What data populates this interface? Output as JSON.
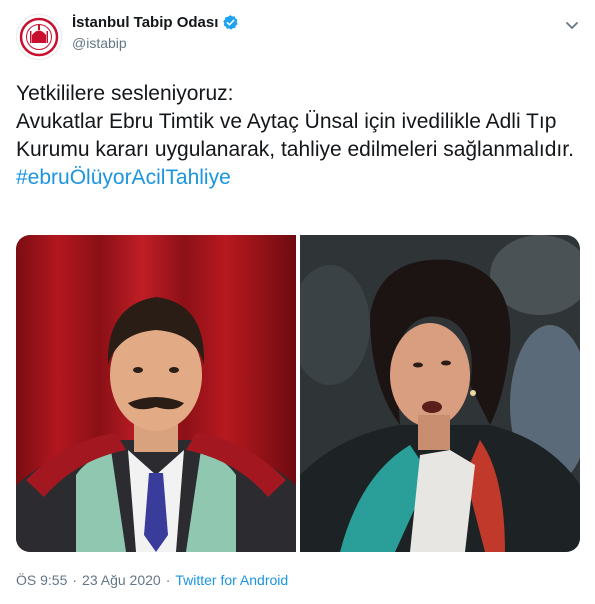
{
  "user": {
    "display_name": "İstanbul Tabip Odası",
    "handle": "@istabip",
    "verified": true,
    "avatar_icon": "medical-chamber-logo"
  },
  "tweet": {
    "text": "Yetkililere sesleniyoruz:\nAvukatlar Ebru Timtik ve Aytaç Ünsal için ivedilikle Adli Tıp Kurumu kararı uygulanarak, tahliye edilmeleri sağlanmalıdır.",
    "hashtag": "#ebruÖlüyorAcilTahliye"
  },
  "media": {
    "photos": [
      {
        "subject": "man-in-lawyer-robe-red-curtain"
      },
      {
        "subject": "woman-lawyer-speaking-in-crowd"
      }
    ]
  },
  "meta": {
    "time": "ÖS 9:55",
    "separator": "·",
    "date": "23 Ağu 2020",
    "source": "Twitter for Android"
  },
  "colors": {
    "link": "#1b95e0",
    "secondary_text": "#657786",
    "verified": "#1da1f2"
  }
}
